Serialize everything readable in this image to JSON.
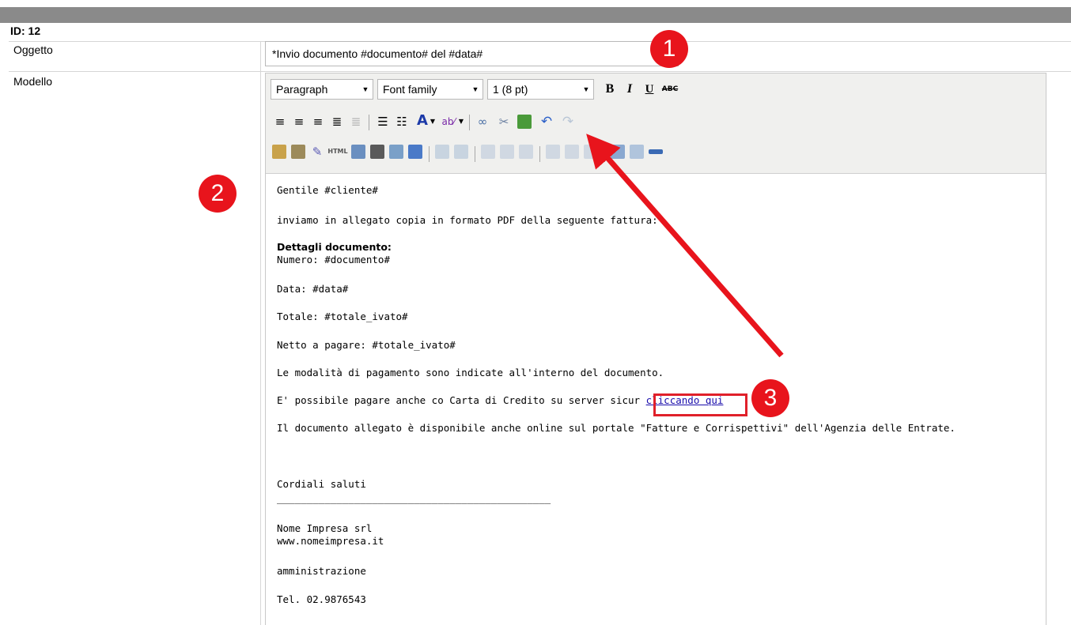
{
  "header": {
    "id_label": "ID: 12"
  },
  "rows": {
    "subject_label": "Oggetto",
    "model_label": "Modello"
  },
  "subject": {
    "value": "*Invio documento #documento# del #data#"
  },
  "toolbar": {
    "format_select": "Paragraph",
    "font_select": "Font family",
    "size_select": "1 (8 pt)",
    "bold": "B",
    "italic": "I",
    "underline": "U",
    "strike": "ABC",
    "font_color": "A"
  },
  "body": {
    "greeting": "Gentile #cliente#",
    "intro": "inviamo in allegato copia in formato PDF della seguente fattura:",
    "details_title": "Dettagli documento:",
    "numero": "Numero: #documento#",
    "data": "Data: #data#",
    "totale": "Totale: #totale_ivato#",
    "netto": "Netto a pagare: #totale_ivato#",
    "modalita": "Le modalità di pagamento sono indicate all'interno del documento.",
    "pay_text": "E' possibile pagare anche co  Carta di Credito su server sicur",
    "pay_link": "cliccando qui",
    "online": "Il documento allegato è disponibile anche online sul portale \"Fatture e Corrispettivi\" dell'Agenzia delle Entrate.",
    "saluti": "Cordiali saluti",
    "divider": "______________________________________________",
    "company": "Nome Impresa srl",
    "website": "www.nomeimpresa.it",
    "dept": "amministrazione",
    "phone": "Tel. 02.9876543"
  },
  "annotations": {
    "badge1": "1",
    "badge2": "2",
    "badge3": "3",
    "accent": "#e8141c"
  }
}
